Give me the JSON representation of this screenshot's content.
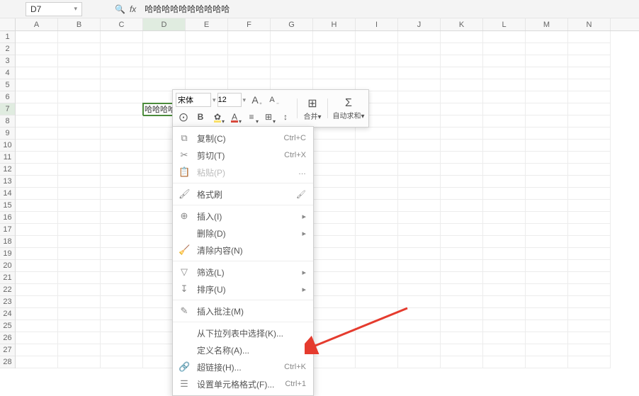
{
  "namebox": {
    "ref": "D7"
  },
  "formula_bar": {
    "fx": "fx",
    "value": "哈哈哈哈哈哈哈哈哈哈"
  },
  "columns": [
    "A",
    "B",
    "C",
    "D",
    "E",
    "F",
    "G",
    "H",
    "I",
    "J",
    "K",
    "L",
    "M",
    "N"
  ],
  "selected_col": "D",
  "selected_row": 7,
  "row_count": 28,
  "cell_d7": "哈哈哈哈哈哈哈哈哈哈",
  "mini_toolbar": {
    "font": "宋体",
    "size": "12",
    "inc_font": "A",
    "dec_font": "A",
    "merge_ico": "⊞",
    "merge_label": "合并",
    "sum_ico": "Σ",
    "sum_label": "自动求和"
  },
  "context_menu": [
    {
      "icon": "⧉",
      "label": "复制(C)",
      "shortcut": "Ctrl+C",
      "enabled": true
    },
    {
      "icon": "✂",
      "label": "剪切(T)",
      "shortcut": "Ctrl+X",
      "enabled": true
    },
    {
      "icon": "📋",
      "label": "粘贴(P)",
      "shortcut": "…",
      "enabled": false
    },
    {
      "sep": true
    },
    {
      "icon": "🖌",
      "label": "格式刷",
      "shortcut": "",
      "enabled": true,
      "right_icon": "🖌"
    },
    {
      "sep": true
    },
    {
      "icon": "⊕",
      "label": "插入(I)",
      "shortcut": "▸",
      "enabled": true
    },
    {
      "icon": "",
      "label": "删除(D)",
      "shortcut": "▸",
      "enabled": true
    },
    {
      "icon": "🧹",
      "label": "清除内容(N)",
      "shortcut": "",
      "enabled": true
    },
    {
      "sep": true
    },
    {
      "icon": "▽",
      "label": "筛选(L)",
      "shortcut": "▸",
      "enabled": true
    },
    {
      "icon": "↧",
      "label": "排序(U)",
      "shortcut": "▸",
      "enabled": true
    },
    {
      "sep": true
    },
    {
      "icon": "✎",
      "label": "插入批注(M)",
      "shortcut": "",
      "enabled": true
    },
    {
      "sep": true
    },
    {
      "icon": "",
      "label": "从下拉列表中选择(K)...",
      "shortcut": "",
      "enabled": true
    },
    {
      "icon": "",
      "label": "定义名称(A)...",
      "shortcut": "",
      "enabled": true
    },
    {
      "icon": "🔗",
      "label": "超链接(H)...",
      "shortcut": "Ctrl+K",
      "enabled": true
    },
    {
      "icon": "☰",
      "label": "设置单元格格式(F)...",
      "shortcut": "Ctrl+1",
      "enabled": true
    }
  ]
}
